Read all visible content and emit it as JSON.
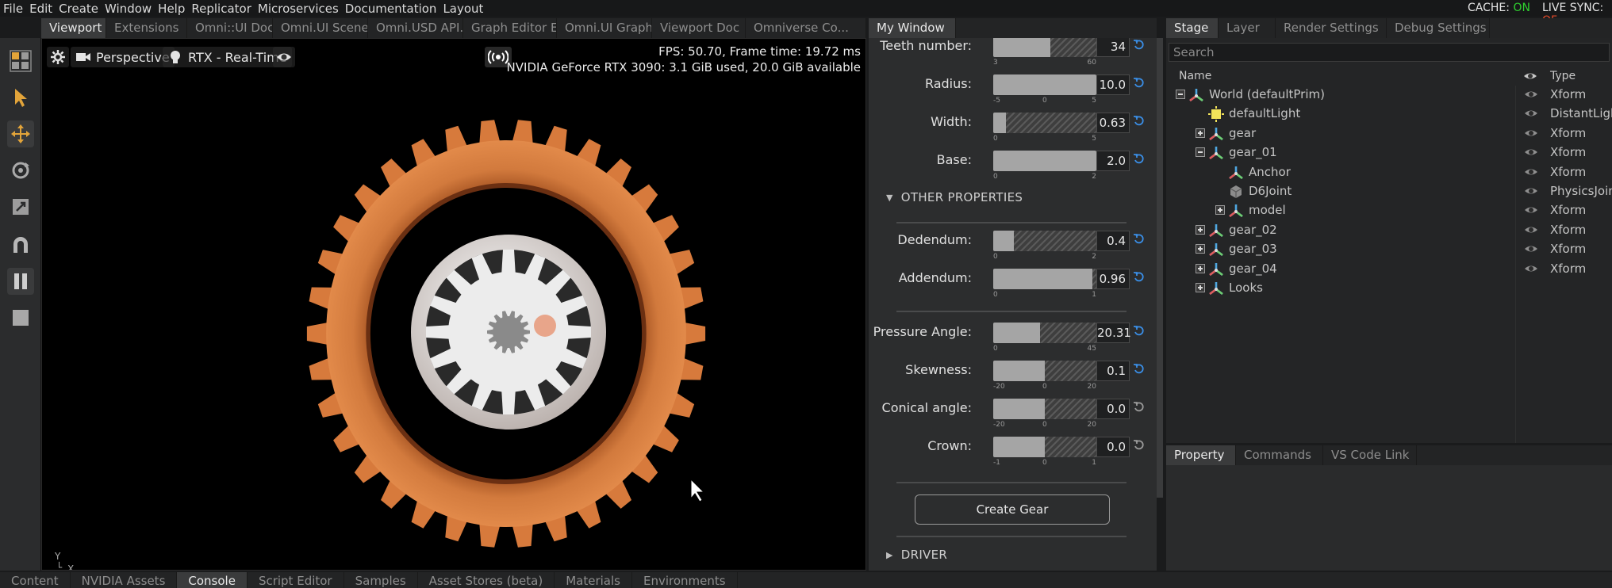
{
  "menu": [
    "File",
    "Edit",
    "Create",
    "Window",
    "Help",
    "Replicator",
    "Microservices",
    "Documentation",
    "Layout"
  ],
  "status": {
    "cache_label": "CACHE:",
    "cache_value": "ON",
    "live_label": "LIVE SYNC:",
    "live_value": "OF"
  },
  "viewport_tabs": [
    "Viewport",
    "Extensions",
    "Omni::UI Doc",
    "Omni.UI Scene...",
    "Omni.USD API...",
    "Graph Editor E...",
    "Omni.UI Graph...",
    "Viewport Doc",
    "Omniverse Co..."
  ],
  "viewport": {
    "camera": "Perspective",
    "renderer": "RTX - Real-Time",
    "fps_line": "FPS: 50.70, Frame time: 19.72 ms",
    "gpu_line": "NVIDIA GeForce RTX 3090: 3.1 GiB used,  20.0 GiB available",
    "axis_y": "Y",
    "axis_x": "X"
  },
  "mywindow": {
    "tab": "My Window",
    "props": [
      {
        "label": "Teeth number:",
        "value": "34",
        "fill": 0.55,
        "ticks": [
          "3",
          "60"
        ],
        "reset_active": true
      },
      {
        "label": "Radius:",
        "value": "10.0",
        "fill": 1.0,
        "ticks": [
          "-5",
          "0",
          "5"
        ],
        "reset_active": true
      },
      {
        "label": "Width:",
        "value": "0.63",
        "fill": 0.12,
        "ticks": [
          "0",
          "5"
        ],
        "reset_active": true
      },
      {
        "label": "Base:",
        "value": "2.0",
        "fill": 1.0,
        "ticks": [
          "0",
          "2"
        ],
        "reset_active": true
      },
      {
        "label": "Dedendum:",
        "value": "0.4",
        "fill": 0.2,
        "ticks": [
          "0",
          "2"
        ],
        "reset_active": true
      },
      {
        "label": "Addendum:",
        "value": "0.96",
        "fill": 0.96,
        "ticks": [
          "0",
          "1"
        ],
        "reset_active": true
      },
      {
        "label": "Pressure Angle:",
        "value": "20.31",
        "fill": 0.45,
        "ticks": [
          "0",
          "45"
        ],
        "reset_active": true
      },
      {
        "label": "Skewness:",
        "value": "0.1",
        "fill": 0.5,
        "ticks": [
          "-20",
          "0",
          "20"
        ],
        "reset_active": true
      },
      {
        "label": "Conical angle:",
        "value": "0.0",
        "fill": 0.5,
        "ticks": [
          "-20",
          "0",
          "20"
        ],
        "reset_active": false
      },
      {
        "label": "Crown:",
        "value": "0.0",
        "fill": 0.5,
        "ticks": [
          "-1",
          "0",
          "1"
        ],
        "reset_active": false
      }
    ],
    "section_other": "OTHER PROPERTIES",
    "section_driver": "DRIVER",
    "create_button": "Create Gear"
  },
  "stage_tabs": [
    "Stage",
    "Layer",
    "Render Settings",
    "Debug Settings"
  ],
  "stage": {
    "search_placeholder": "Search",
    "col_name": "Name",
    "col_type": "Type",
    "rows": [
      {
        "label": "World (defaultPrim)",
        "type": "Xform",
        "level": 0,
        "expander": "minus",
        "icon": "xform-icon"
      },
      {
        "label": "defaultLight",
        "type": "DistantLigh",
        "level": 1,
        "expander": "none",
        "icon": "light-icon"
      },
      {
        "label": "gear",
        "type": "Xform",
        "level": 1,
        "expander": "plus",
        "icon": "xform-icon"
      },
      {
        "label": "gear_01",
        "type": "Xform",
        "level": 1,
        "expander": "minus",
        "icon": "xform-icon"
      },
      {
        "label": "Anchor",
        "type": "Xform",
        "level": 2,
        "expander": "none",
        "icon": "xform-icon"
      },
      {
        "label": "D6Joint",
        "type": "PhysicsJoin",
        "level": 2,
        "expander": "none",
        "icon": "joint-icon"
      },
      {
        "label": "model",
        "type": "Xform",
        "level": 2,
        "expander": "plus",
        "icon": "xform-icon"
      },
      {
        "label": "gear_02",
        "type": "Xform",
        "level": 1,
        "expander": "plus",
        "icon": "xform-icon"
      },
      {
        "label": "gear_03",
        "type": "Xform",
        "level": 1,
        "expander": "plus",
        "icon": "xform-icon"
      },
      {
        "label": "gear_04",
        "type": "Xform",
        "level": 1,
        "expander": "plus",
        "icon": "xform-icon"
      },
      {
        "label": "Looks",
        "type": "",
        "level": 1,
        "expander": "plus",
        "icon": "xform-icon"
      }
    ]
  },
  "property_tabs": [
    "Property",
    "Commands",
    "VS Code Link"
  ],
  "bottom_tabs": [
    "Content",
    "NVIDIA Assets",
    "Console",
    "Script Editor",
    "Samples",
    "Asset Stores (beta)",
    "Materials",
    "Environments"
  ],
  "colors": {
    "accent_blue": "#3a8ee6",
    "gear_orange": "#c8662d",
    "status_on": "#2fd12f",
    "status_off": "#e04a2a"
  }
}
